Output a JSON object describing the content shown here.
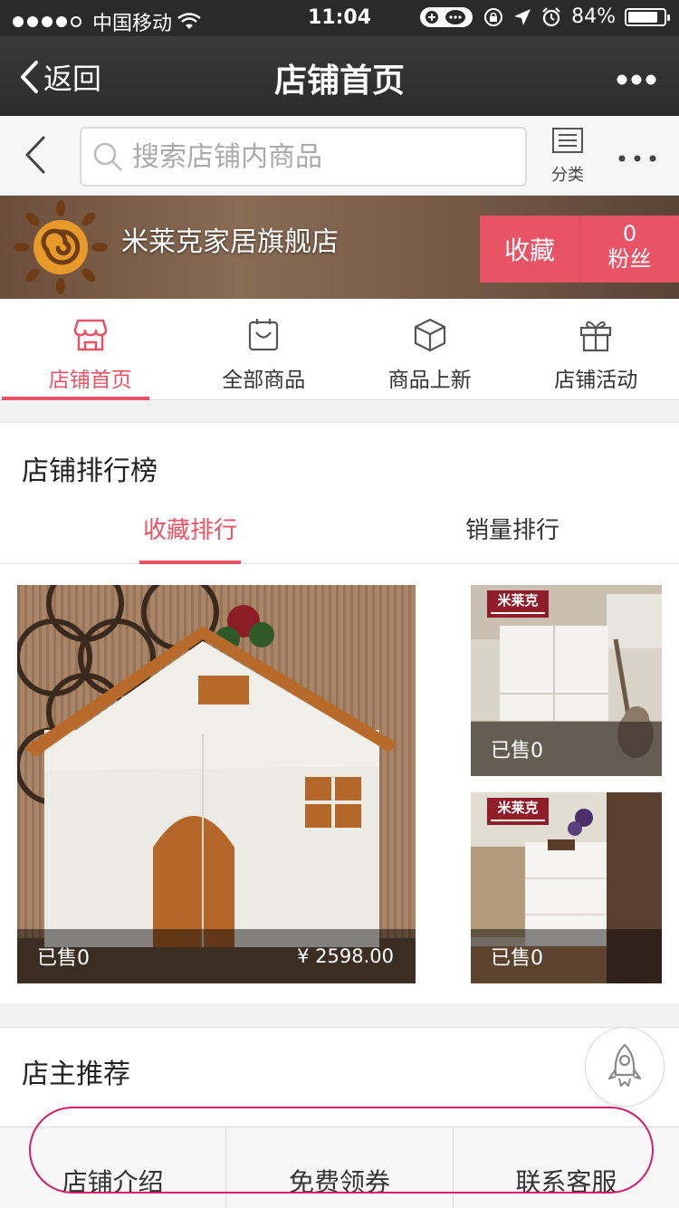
{
  "status_bar": {
    "carrier": "中国移动",
    "time": "11:04",
    "battery": "84%",
    "battery_level": 0.84
  },
  "nav": {
    "back_label": "返回",
    "title": "店铺首页",
    "more_icon": "more-dots-icon"
  },
  "search": {
    "placeholder": "搜索店铺内商品",
    "category_label": "分类"
  },
  "store": {
    "name": "米莱克家居旗舰店",
    "favorite_label": "收藏",
    "fans_count": "0",
    "fans_label": "粉丝"
  },
  "shop_tabs": [
    {
      "label": "店铺首页",
      "icon": "store-icon",
      "active": true
    },
    {
      "label": "全部商品",
      "icon": "bag-icon",
      "active": false
    },
    {
      "label": "商品上新",
      "icon": "box-icon",
      "active": false
    },
    {
      "label": "店铺活动",
      "icon": "gift-icon",
      "active": false
    }
  ],
  "ranking": {
    "title": "店铺排行榜",
    "tabs": [
      {
        "label": "收藏排行",
        "active": true
      },
      {
        "label": "销量排行",
        "active": false
      }
    ],
    "products": [
      {
        "sold": "已售0",
        "price": "¥ 2598.00"
      },
      {
        "sold": "已售0",
        "brand": "米莱克"
      },
      {
        "sold": "已售0",
        "brand": "米莱克"
      }
    ]
  },
  "recommend": {
    "title": "店主推荐"
  },
  "bottom_bar": [
    {
      "label": "店铺介绍"
    },
    {
      "label": "免费领券"
    },
    {
      "label": "联系客服"
    }
  ],
  "colors": {
    "accent": "#e95366",
    "highlight_ring": "#d51f6a",
    "navbar": "#2b2b2b"
  }
}
